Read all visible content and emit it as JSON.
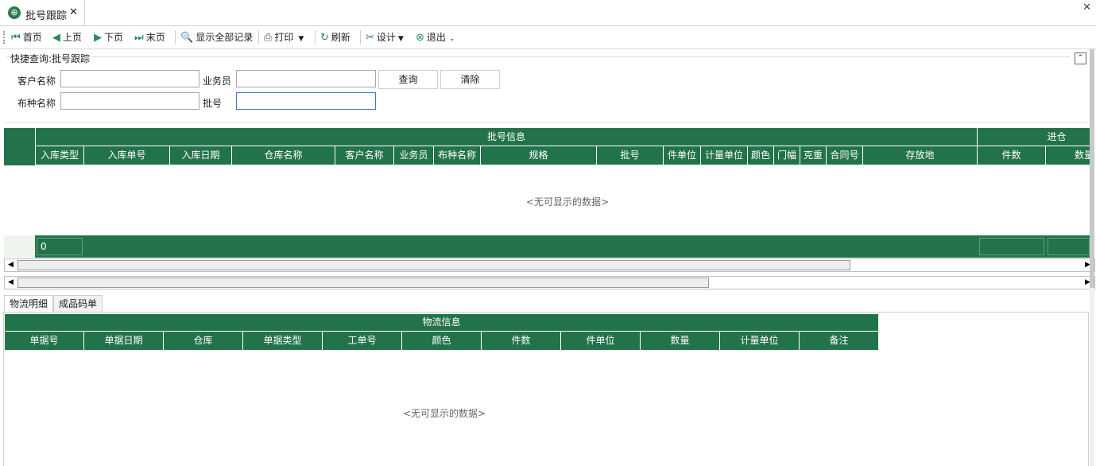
{
  "window": {
    "tab_title": "批号跟踪",
    "tab_icon": "app-globe-icon",
    "tab_close_glyph": "✕",
    "window_close_glyph": "✕"
  },
  "toolbar": {
    "first": "首页",
    "prev": "上页",
    "next": "下页",
    "last": "末页",
    "show_all": "显示全部记录",
    "print": "打印",
    "refresh": "刷新",
    "design": "设计",
    "exit": "退出"
  },
  "quick_search": {
    "title": "快捷查询:批号跟踪",
    "fields": {
      "customer_label": "客户名称",
      "customer_value": "",
      "salesman_label": "业务员",
      "salesman_value": "",
      "fabric_label": "布种名称",
      "fabric_value": "",
      "batch_label": "批号",
      "batch_value": ""
    },
    "query_button": "查询",
    "clear_button": "清除"
  },
  "grid1": {
    "band_main": "批号信息",
    "band_right": "进仓",
    "columns": [
      "入库类型",
      "入库单号",
      "入库日期",
      "仓库名称",
      "客户名称",
      "业务员",
      "布种名称",
      "规格",
      "批号",
      "件单位",
      "计量单位",
      "颜色",
      "门幅",
      "克重",
      "合同号",
      "存放地",
      "件数",
      "数量"
    ],
    "empty_text": "<无可显示的数据>",
    "footer_count": "0"
  },
  "bottom_tabs": {
    "tab1": "物流明细",
    "tab2": "成品码单"
  },
  "grid2": {
    "band": "物流信息",
    "columns": [
      "单据号",
      "单据日期",
      "仓库",
      "单据类型",
      "工单号",
      "颜色",
      "件数",
      "件单位",
      "数量",
      "计量单位",
      "备注"
    ],
    "empty_text": "<无可显示的数据>"
  },
  "colors": {
    "header_green": "#23734a",
    "accent_blue": "#3d7ac9"
  }
}
